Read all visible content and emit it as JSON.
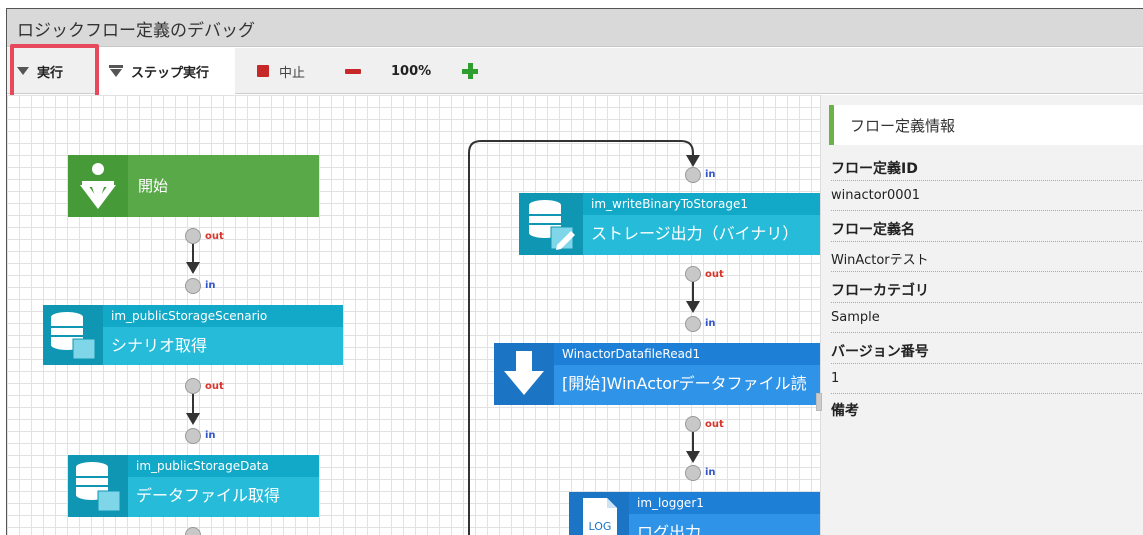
{
  "window": {
    "title": "ロジックフロー定義のデバッグ"
  },
  "toolbar": {
    "run_label": "実行",
    "step_label": "ステップ実行",
    "stop_label": "中止",
    "zoom_level": "100%"
  },
  "flow": {
    "ports": {
      "in": "in",
      "out": "out"
    },
    "start_node": {
      "label": "開始"
    },
    "nodes": [
      {
        "id": "im_publicStorageScenario",
        "label": "シナリオ取得"
      },
      {
        "id": "im_publicStorageData",
        "label": "データファイル取得"
      },
      {
        "id": "im_writeBinaryToStorage1",
        "label": "ストレージ出力（バイナリ）"
      },
      {
        "id": "WinactorDatafileRead1",
        "label": "[開始]WinActorデータファイル読"
      },
      {
        "id": "im_logger1",
        "label": "ログ出力"
      }
    ],
    "log_icon_text": "LOG"
  },
  "info_panel": {
    "title": "フロー定義情報",
    "fields": [
      {
        "key": "フロー定義ID",
        "value": "winactor0001"
      },
      {
        "key": "フロー定義名",
        "value": "WinActorテスト"
      },
      {
        "key": "フローカテゴリ",
        "value": "Sample"
      },
      {
        "key": "バージョン番号",
        "value": "1"
      },
      {
        "key": "備考",
        "value": ""
      }
    ]
  },
  "colors": {
    "highlight": "#e8485b",
    "start_node": "#5aa949",
    "storage_node": "#26bcd9",
    "winactor_node": "#2f93e8"
  }
}
